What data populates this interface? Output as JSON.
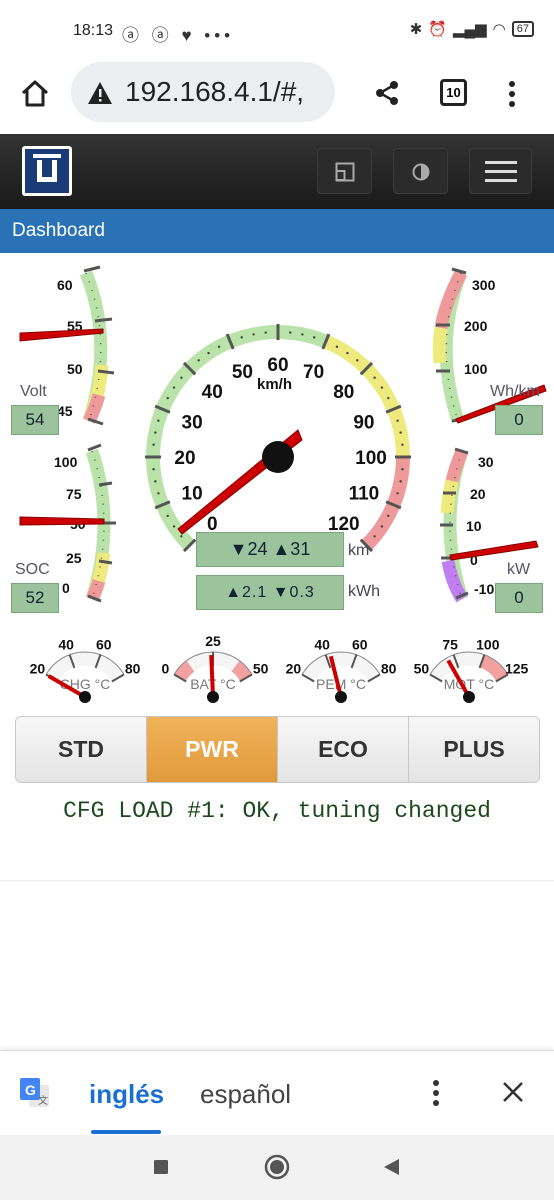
{
  "status_bar": {
    "time": "18:13",
    "notifications": "ⓐ ⓐ ♥ •••",
    "battery": "67"
  },
  "browser": {
    "url": "192.168.4.1/#,",
    "tab_count": "10"
  },
  "app": {
    "title": "Dashboard"
  },
  "gauges": {
    "volt": {
      "label": "Volt",
      "value": "54",
      "ticks": [
        "60",
        "55",
        "50",
        "45"
      ],
      "needle": 55.5
    },
    "soc": {
      "label": "SOC",
      "value": "52",
      "ticks": [
        "100",
        "75",
        "50",
        "25",
        "0"
      ],
      "needle": 52
    },
    "whkm": {
      "label": "Wh/km",
      "value": "0",
      "ticks": [
        "300",
        "200",
        "100"
      ],
      "needle": 0
    },
    "kw": {
      "label": "kW",
      "value": "0",
      "ticks": [
        "30",
        "20",
        "10",
        "0",
        "-10"
      ],
      "needle": 0
    },
    "speed": {
      "unit": "km/h",
      "ticks": [
        "0",
        "10",
        "20",
        "30",
        "40",
        "50",
        "60",
        "70",
        "80",
        "90",
        "100",
        "110",
        "120"
      ],
      "needle": 0
    },
    "chg": {
      "label": "CHG °C",
      "ticks": [
        "20",
        "40",
        "60",
        "80"
      ],
      "needle": 20
    },
    "bat": {
      "label": "BAT °C",
      "ticks": [
        "0",
        "25",
        "50"
      ],
      "needle": 24
    },
    "pem": {
      "label": "PEM °C",
      "ticks": [
        "20",
        "40",
        "60",
        "80"
      ],
      "needle": 43
    },
    "mot": {
      "label": "MOT °C",
      "ticks": [
        "50",
        "75",
        "100",
        "125"
      ],
      "needle": 69
    }
  },
  "trip": {
    "distance": "▼24 ▲31",
    "distance_unit": "km",
    "energy": "▲2.1 ▼0.3",
    "energy_unit": "kWh"
  },
  "modes": [
    "STD",
    "PWR",
    "ECO",
    "PLUS"
  ],
  "active_mode": "PWR",
  "message": "CFG LOAD #1: OK, tuning changed",
  "translate_bar": {
    "lang_from": "inglés",
    "lang_to": "español"
  },
  "colors": {
    "accent": "#2a72b5",
    "mode_active": "#e09a3a",
    "value_box": "#9cc49c"
  },
  "icons": [
    "home-icon",
    "warning-icon",
    "share-icon",
    "tabs-icon",
    "menu-kebab-icon",
    "layout-icon",
    "contrast-icon",
    "hamburger-icon",
    "translate-icon",
    "close-icon",
    "stop-icon",
    "home-circle-icon",
    "back-icon"
  ]
}
